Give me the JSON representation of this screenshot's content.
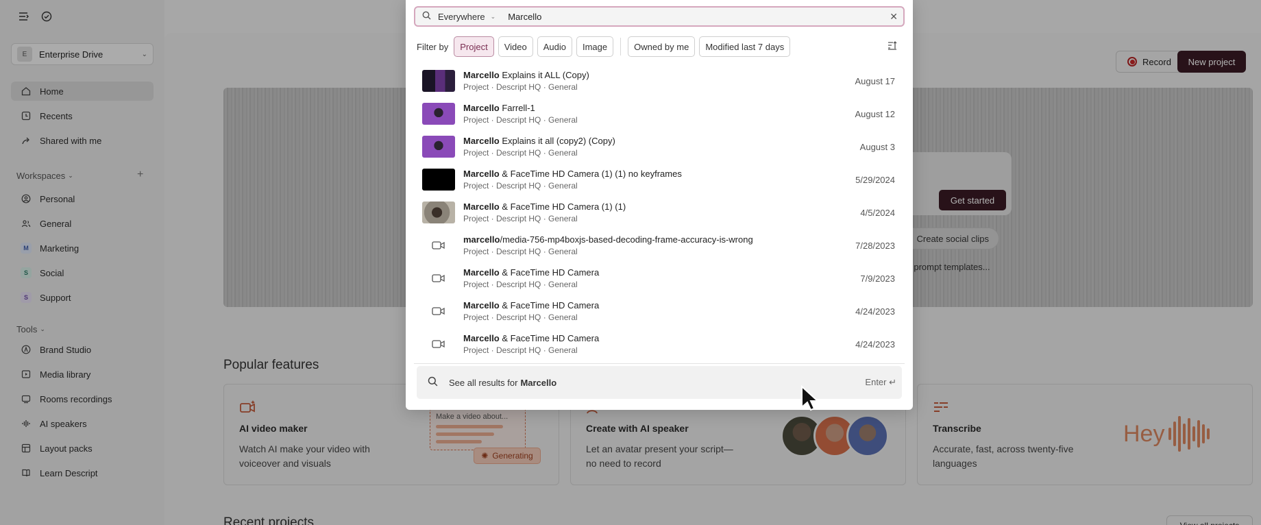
{
  "sidebar": {
    "drive": {
      "initial": "E",
      "name": "Enterprise Drive"
    },
    "nav": [
      {
        "label": "Home",
        "icon": "home-icon"
      },
      {
        "label": "Recents",
        "icon": "clock-icon"
      },
      {
        "label": "Shared with me",
        "icon": "share-icon"
      }
    ],
    "workspaces_label": "Workspaces",
    "workspaces": [
      {
        "label": "Personal",
        "icon": "user-icon"
      },
      {
        "label": "General",
        "icon": "users-icon"
      },
      {
        "label": "Marketing",
        "badge": "M",
        "color": "#dbe4f5",
        "text_color": "#3d5ba8"
      },
      {
        "label": "Social",
        "badge": "S",
        "color": "#d6ece6",
        "text_color": "#2c7b65"
      },
      {
        "label": "Support",
        "badge": "S",
        "color": "#e6def3",
        "text_color": "#6b4aa3"
      }
    ],
    "tools_label": "Tools",
    "tools": [
      {
        "label": "Brand Studio",
        "icon": "brand-icon"
      },
      {
        "label": "Media library",
        "icon": "media-icon"
      },
      {
        "label": "Rooms recordings",
        "icon": "rooms-icon"
      },
      {
        "label": "AI speakers",
        "icon": "speaker-icon"
      },
      {
        "label": "Layout packs",
        "icon": "layout-icon"
      },
      {
        "label": "Learn Descript",
        "icon": "book-icon"
      }
    ]
  },
  "header": {
    "record_label": "Record",
    "new_project_label": "New project"
  },
  "hero": {
    "get_started_label": "Get started",
    "social_clips_label": "Create social clips",
    "prompt_templates_text": "se prompt templates..."
  },
  "popular": {
    "title": "Popular features",
    "cards": [
      {
        "title": "AI video maker",
        "desc": "Watch AI make your video with voiceover and visuals",
        "mini_doc": "Make a video about...",
        "generating": "Generating"
      },
      {
        "title": "Create with AI speaker",
        "desc": "Let an avatar present your script—no need to record"
      },
      {
        "title": "Transcribe",
        "desc": "Accurate, fast, across twenty-five languages",
        "hey": "Hey"
      }
    ]
  },
  "recent": {
    "title": "Recent projects",
    "view_all_label": "View all projects"
  },
  "search": {
    "scope": "Everywhere",
    "query": "Marcello",
    "filter_label": "Filter by",
    "filters": [
      "Project",
      "Video",
      "Audio",
      "Image"
    ],
    "filters2": [
      "Owned by me",
      "Modified last 7 days"
    ],
    "active_filter": "Project",
    "results": [
      {
        "bold": "Marcello",
        "rest": " Explains it ALL (Copy)",
        "sub": "Project · Descript HQ · General",
        "date": "August 17",
        "thumb": "dark-purple"
      },
      {
        "bold": "Marcello",
        "rest": " Farrell-1",
        "sub": "Project · Descript HQ · General",
        "date": "August 12",
        "thumb": "purple"
      },
      {
        "bold": "Marcello",
        "rest": " Explains it all (copy2) (Copy)",
        "sub": "Project · Descript HQ · General",
        "date": "August 3",
        "thumb": "purple"
      },
      {
        "bold": "Marcello",
        "rest": " & FaceTime HD Camera (1) (1) no keyframes",
        "sub": "Project · Descript HQ · General",
        "date": "5/29/2024",
        "thumb": "black"
      },
      {
        "bold": "Marcello",
        "rest": " & FaceTime HD Camera (1) (1)",
        "sub": "Project · Descript HQ · General",
        "date": "4/5/2024",
        "thumb": "room"
      },
      {
        "bold": "marcello",
        "rest": "/media-756-mp4boxjs-based-decoding-frame-accuracy-is-wrong",
        "sub": "Project · Descript HQ · General",
        "date": "7/28/2023",
        "thumb": "icon"
      },
      {
        "bold": "Marcello",
        "rest": " & FaceTime HD Camera",
        "sub": "Project · Descript HQ · General",
        "date": "7/9/2023",
        "thumb": "icon"
      },
      {
        "bold": "Marcello",
        "rest": " & FaceTime HD Camera",
        "sub": "Project · Descript HQ · General",
        "date": "4/24/2023",
        "thumb": "icon"
      },
      {
        "bold": "Marcello",
        "rest": " & FaceTime HD Camera",
        "sub": "Project · Descript HQ · General",
        "date": "4/24/2023",
        "thumb": "icon"
      }
    ],
    "see_all_prefix": "See all results for",
    "see_all_term": "Marcello",
    "enter_hint": "Enter ↵"
  },
  "colors": {
    "accent_dark": "#3a1b24",
    "chip_active": "#f6e7ee",
    "search_border": "#d5a7bd",
    "warm": "#d9865f"
  }
}
